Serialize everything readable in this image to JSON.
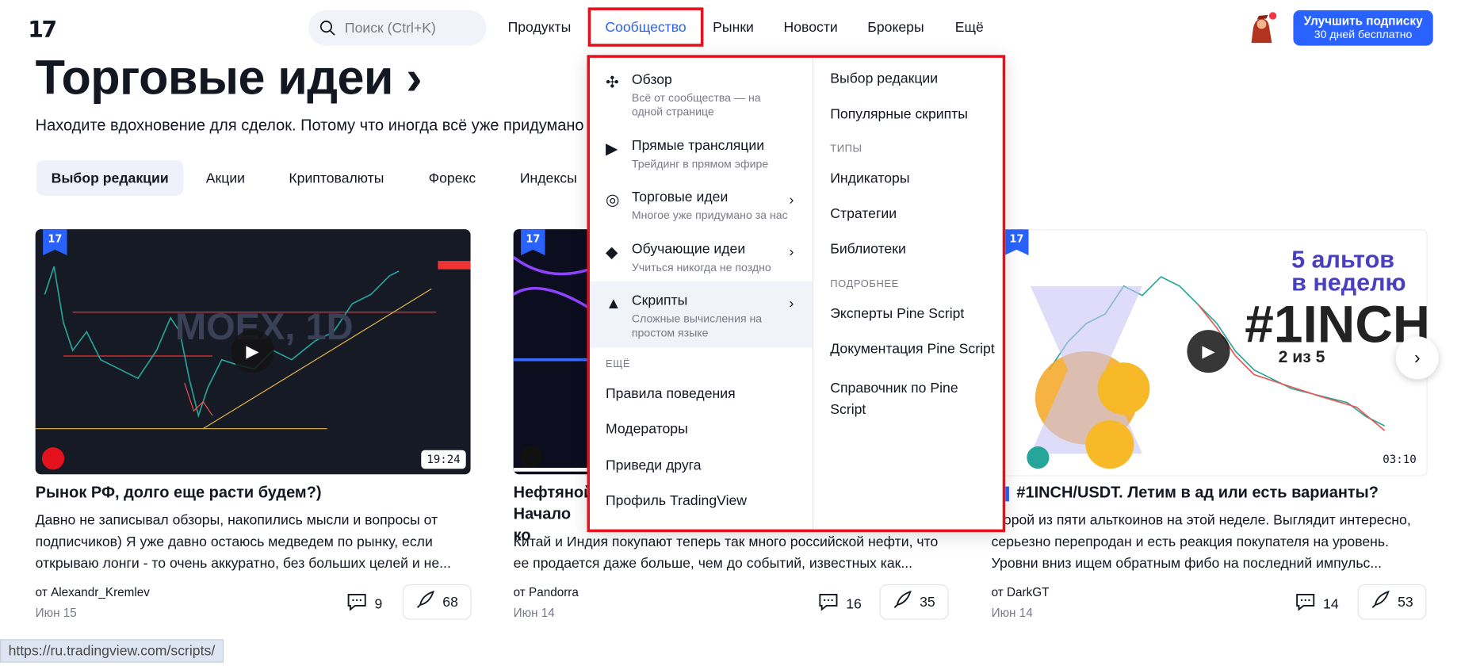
{
  "header": {
    "logo": "17",
    "search_placeholder": "Поиск (Ctrl+K)",
    "nav": [
      "Продукты",
      "Сообщество",
      "Рынки",
      "Новости",
      "Брокеры",
      "Ещё"
    ],
    "upgrade_line1": "Улучшить подписку",
    "upgrade_line2": "30 дней бесплатно"
  },
  "page": {
    "title": "Торговые идеи",
    "title_chevron": "›",
    "subtitle": "Находите вдохновение для сделок. Потому что иногда всё уже придумано",
    "chips": [
      "Выбор редакции",
      "Акции",
      "Криптовалюты",
      "Форекс",
      "Индексы"
    ]
  },
  "cards": [
    {
      "title": "Рынок РФ, долго еще расти будем?)",
      "desc": "Давно не записывал обзоры, накопились мысли и вопросы от подписчиков) Я уже давно остаюсь медведем по рынку, если открываю лонги - то очень аккуратно, без больших целей и не...",
      "author": "от Alexandr_Kremlev",
      "date": "Июн 15",
      "comments": "9",
      "boosts": "68",
      "duration": "19:24",
      "watermark": "MOEX, 1D"
    },
    {
      "title": "Нефтяной рынок: санкции и потолок цен. Начало конца?",
      "title_visible_line1": "Нефтяной",
      "title_visible_line2": "Начало ко",
      "desc": "Китай и Индия покупают теперь так много российской нефти, что ее продается даже больше, чем до событий, известных как...",
      "author": "от Pandorra",
      "date": "Июн 14",
      "comments": "16",
      "boosts": "35"
    },
    {
      "title": "#1INCH/USDT. Летим в ад или есть варианты?",
      "desc_line1": "орой из пяти альткоинов на этой неделе. Выглядит интересно,",
      "desc_line2": "серьезно перепродан и есть реакция покупателя на уровень.",
      "desc_line3": "Уровни вниз ищем обратным фибо на последний импульс...",
      "author": "от DarkGT",
      "date": "Июн 14",
      "comments": "14",
      "boosts": "53",
      "duration": "03:10",
      "thumb_text1": "5 альтов",
      "thumb_text2": "в неделю",
      "thumb_text3": "#1INCH",
      "thumb_text4": "2 из 5"
    }
  ],
  "dropdown": {
    "left_items": [
      {
        "title": "Обзор",
        "desc": "Всё от сообщества — на одной странице",
        "icon": "shapes-icon"
      },
      {
        "title": "Прямые трансляции",
        "desc": "Трейдинг в прямом эфире",
        "icon": "live-icon"
      },
      {
        "title": "Торговые идеи",
        "desc": "Многое уже придумано за нас",
        "icon": "bulb-icon"
      },
      {
        "title": "Обучающие идеи",
        "desc": "Учиться никогда не поздно",
        "icon": "graduation-icon"
      },
      {
        "title": "Скрипты",
        "desc": "Сложные вычисления на простом языке",
        "icon": "mountain-icon"
      }
    ],
    "more_label": "ЕЩЁ",
    "more_links": [
      "Правила поведения",
      "Модераторы",
      "Приведи друга",
      "Профиль TradingView"
    ],
    "right_top": [
      "Выбор редакции",
      "Популярные скрипты"
    ],
    "types_label": "ТИПЫ",
    "types": [
      "Индикаторы",
      "Стратегии",
      "Библиотеки"
    ],
    "more2_label": "ПОДРОБНЕЕ",
    "details": [
      "Эксперты Pine Script",
      "Документация Pine Script",
      "Справочник по Pine Script"
    ]
  },
  "status_url": "https://ru.tradingview.com/scripts/",
  "colors": {
    "accent": "#2962ff",
    "highlight": "#e3111b"
  }
}
